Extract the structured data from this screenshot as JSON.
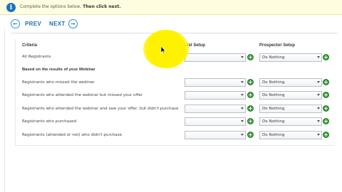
{
  "notice": {
    "text": "Complete the options below,",
    "bold": "Then click next."
  },
  "nav": {
    "prev_label": "PREV",
    "next_label": "NEXT"
  },
  "table": {
    "headers": {
      "criteria": "Criteria",
      "list_setup": "List Setup",
      "prospector_setup": "Prospector Setup"
    },
    "section_title": "Based on the results of your Webinar",
    "rows": [
      {
        "criteria": "All Registrants",
        "list_value": "",
        "prospector_value": "Do Nothing"
      },
      {
        "criteria": "Registrants who missed the webinar",
        "list_value": "",
        "prospector_value": "Do Nothing"
      },
      {
        "criteria": "Registrants who attended the webinar but missed your offer",
        "list_value": "",
        "prospector_value": "Do Nothing"
      },
      {
        "criteria": "Registrants who attended the webinar and saw your offer, but didn't purchase",
        "list_value": "",
        "prospector_value": "Do Nothing"
      },
      {
        "criteria": "Registrants who purchased",
        "list_value": "",
        "prospector_value": "Do Nothing"
      },
      {
        "criteria": "Registrants (attended or not) who didn't purchase",
        "list_value": "",
        "prospector_value": "Do Nothing"
      }
    ]
  },
  "icons": {
    "info": "info-icon",
    "prev": "arrow-left-icon",
    "next": "arrow-right-icon",
    "add": "plus-icon"
  },
  "colors": {
    "accent": "#1f6fb5",
    "notice_bg": "#fefde0",
    "add_green": "#3a9a3a",
    "highlight": "#fff200"
  }
}
